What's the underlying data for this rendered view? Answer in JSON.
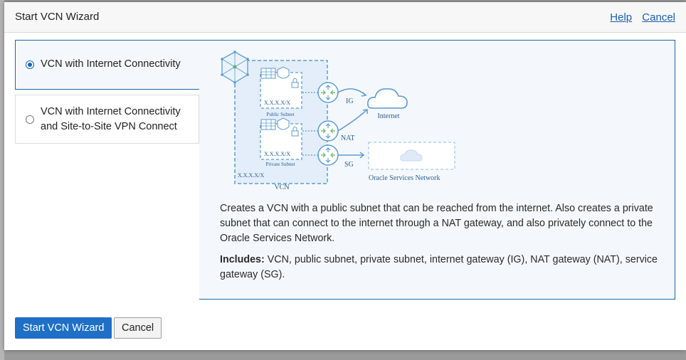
{
  "dialog": {
    "title": "Start VCN Wizard",
    "help_link": "Help",
    "cancel_link": "Cancel"
  },
  "options": [
    {
      "label_line1": "VCN with Internet Connectivity",
      "label_line2": "",
      "selected": true
    },
    {
      "label_line1": "VCN with Internet Connectivity",
      "label_line2": "and Site-to-Site VPN Connect",
      "selected": false
    }
  ],
  "diagram": {
    "vcn_cidr": "X.X.X.X/X",
    "public_subnet_cidr": "X.X.X.X/X",
    "public_subnet_label": "Public Subnet",
    "private_subnet_cidr": "X.X.X.X/X",
    "private_subnet_label": "Private Subnet",
    "vcn_label": "VCN",
    "ig_label": "IG",
    "nat_label": "NAT",
    "sg_label": "SG",
    "internet_label": "Internet",
    "oracle_services_label": "Oracle Services Network"
  },
  "description": "Creates a VCN with a public subnet that can be reached from the internet. Also creates a private subnet that can connect to the internet through a NAT gateway, and also privately connect to the Oracle Services Network.",
  "includes": {
    "heading": "Includes:",
    "text": " VCN, public subnet, private subnet, internet gateway (IG), NAT gateway (NAT), service gateway (SG)."
  },
  "footer": {
    "start_button": "Start VCN Wizard",
    "cancel_button": "Cancel"
  },
  "colors": {
    "accent": "#1f6fc6",
    "diagram_blue": "#5b9bd5"
  }
}
